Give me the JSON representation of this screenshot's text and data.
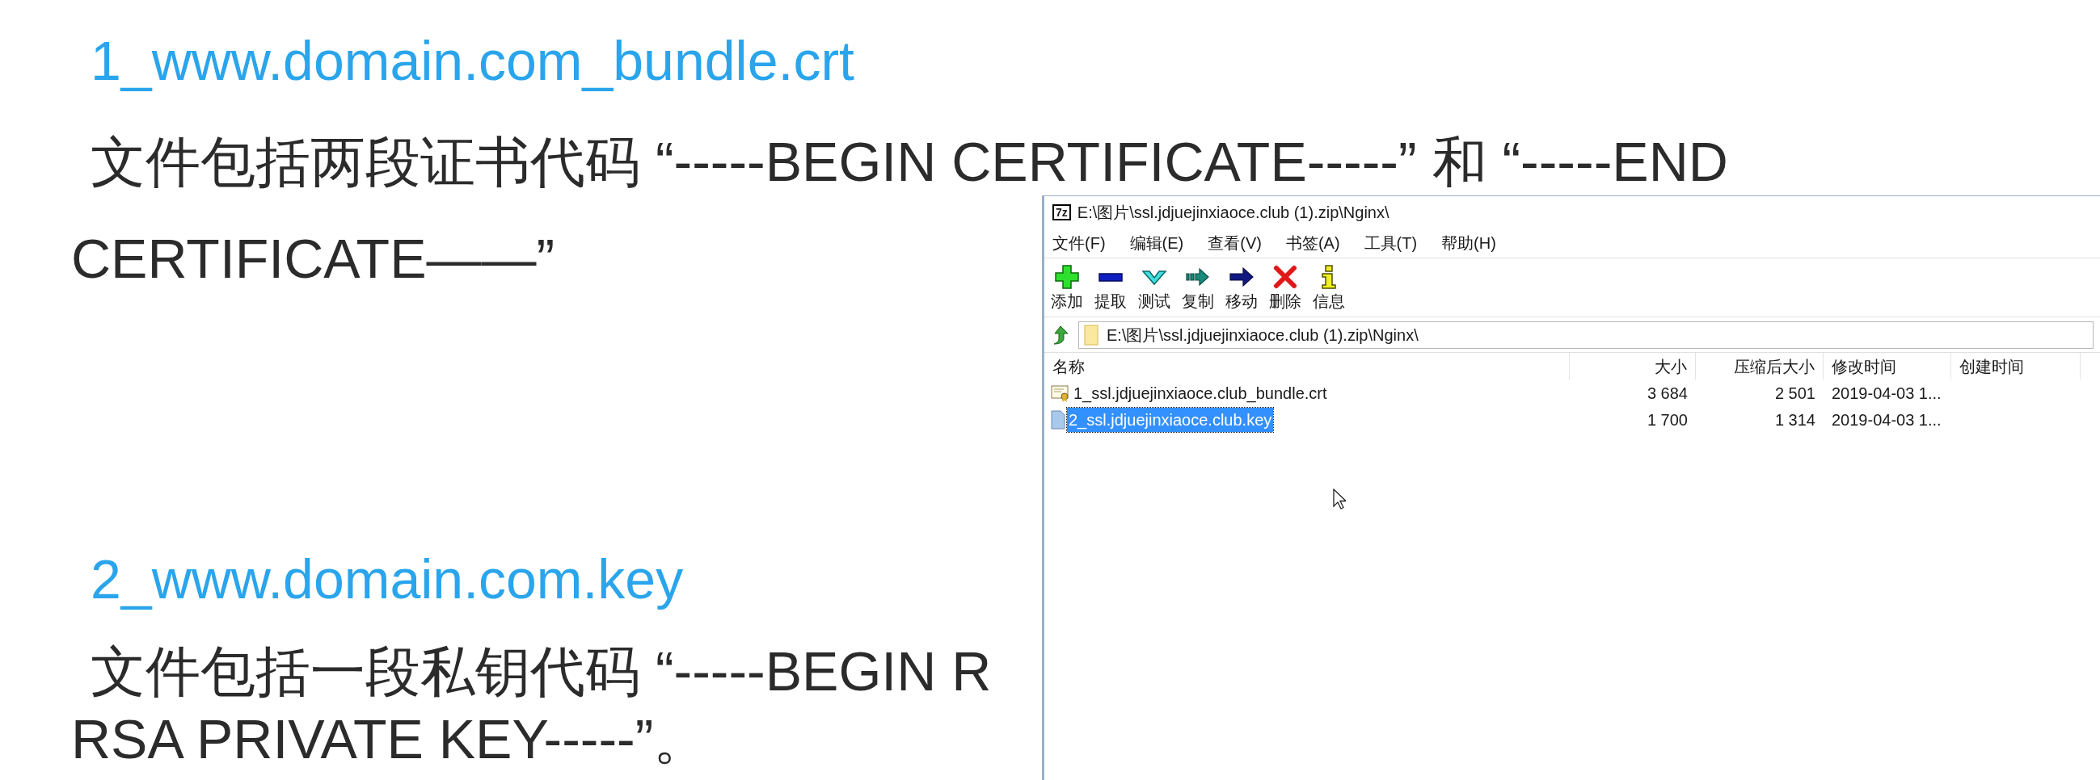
{
  "slide": {
    "sections": [
      {
        "heading": "1_www.domain.com_bundle.crt",
        "lines": [
          "文件包括两段证书代码 “-----BEGIN CERTIFICATE-----” 和 “-----END",
          "CERTIFICATE——”"
        ]
      },
      {
        "heading": "2_www.domain.com.key",
        "lines": [
          "文件包括一段私钥代码 “-----BEGIN R",
          "RSA PRIVATE KEY-----”。"
        ]
      }
    ]
  },
  "window": {
    "title": "E:\\图片\\ssl.jdjuejinxiaoce.club (1).zip\\Nginx\\",
    "app_icon": "7z",
    "menu": [
      "文件(F)",
      "编辑(E)",
      "查看(V)",
      "书签(A)",
      "工具(T)",
      "帮助(H)"
    ],
    "toolbar": [
      {
        "kind": "add",
        "label": "添加"
      },
      {
        "kind": "extract",
        "label": "提取"
      },
      {
        "kind": "test",
        "label": "测试"
      },
      {
        "kind": "copy",
        "label": "复制"
      },
      {
        "kind": "move",
        "label": "移动"
      },
      {
        "kind": "delete",
        "label": "删除"
      },
      {
        "kind": "info",
        "label": "信息"
      }
    ],
    "address": "E:\\图片\\ssl.jdjuejinxiaoce.club (1).zip\\Nginx\\",
    "columns": [
      "名称",
      "大小",
      "压缩后大小",
      "修改时间",
      "创建时间"
    ],
    "rows": [
      {
        "kind": "certificate",
        "name": "1_ssl.jdjuejinxiaoce.club_bundle.crt",
        "size": "3 684",
        "packed": "2 501",
        "modified": "2019-04-03 1...",
        "selected": false
      },
      {
        "kind": "file",
        "name": "2_ssl.jdjuejinxiaoce.club.key",
        "size": "1 700",
        "packed": "1 314",
        "modified": "2019-04-03 1...",
        "selected": true
      }
    ]
  }
}
